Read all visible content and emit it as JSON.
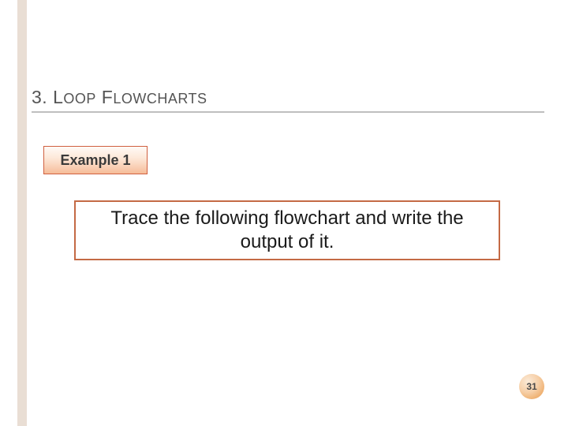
{
  "sidebar": {},
  "heading": {
    "number": "3.",
    "word1_lead": "L",
    "word1_tail": "OOP",
    "word2_lead": "F",
    "word2_tail": "LOWCHARTS"
  },
  "badge": {
    "label": "Example 1"
  },
  "task": {
    "text": "Trace the following flowchart and write the output of it."
  },
  "page": {
    "number": "31"
  }
}
